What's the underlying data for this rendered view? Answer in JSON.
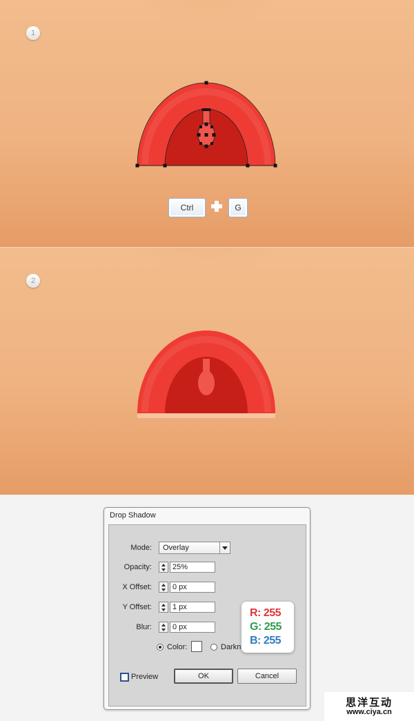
{
  "steps": {
    "step1": "1",
    "step2": "2"
  },
  "shortcut": {
    "key1": "Ctrl",
    "key2": "G",
    "plus": "plus-icon"
  },
  "dialog": {
    "title": "Drop Shadow",
    "mode_label": "Mode:",
    "mode_value": "Overlay",
    "opacity_label": "Opacity:",
    "opacity_value": "25%",
    "xoffset_label": "X Offset:",
    "xoffset_value": "0 px",
    "yoffset_label": "Y Offset:",
    "yoffset_value": "1 px",
    "blur_label": "Blur:",
    "blur_value": "0 px",
    "color_label": "Color:",
    "darkness_label": "Darkn",
    "preview_label": "Preview",
    "ok_label": "OK",
    "cancel_label": "Cancel"
  },
  "rgb_callout": {
    "r": "R: 255",
    "g": "G: 255",
    "b": "B: 255"
  },
  "watermark": {
    "line1": "思洋互动",
    "line2": "www.ciya.cn"
  },
  "colors": {
    "background_top": "#f2bc8c",
    "background_bottom": "#e69c66",
    "shape_outer": "#ee3b34",
    "shape_inner": "#c51f17",
    "shape_accent": "#f0564c",
    "shadow_line": "#f7c4a0",
    "r_text": "#e0353a",
    "g_text": "#2f9a4c",
    "b_text": "#2f7bbf"
  }
}
